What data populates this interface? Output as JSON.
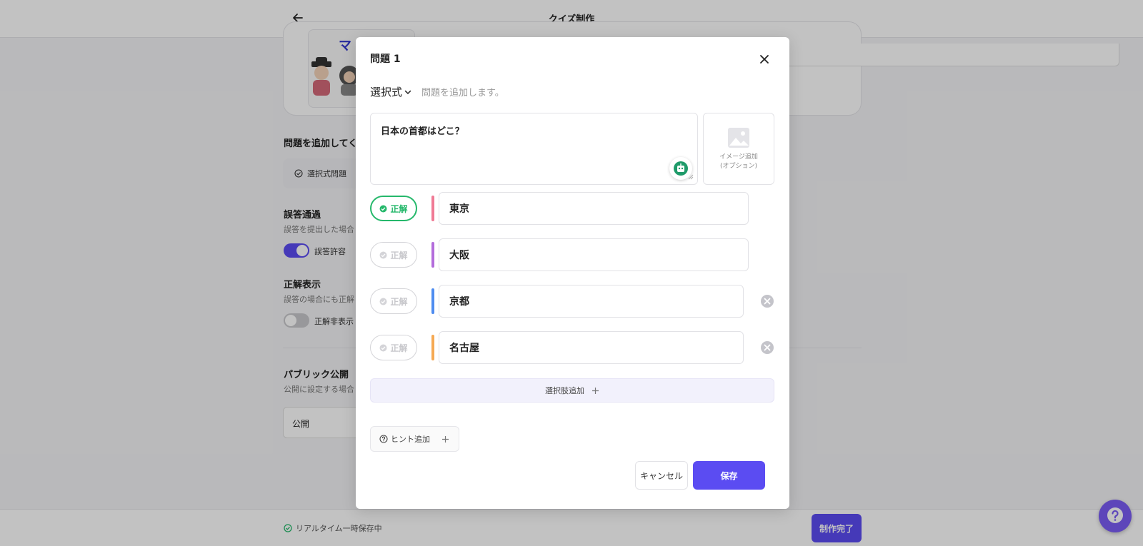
{
  "header": {
    "title": "クイズ制作"
  },
  "background": {
    "card_logo_text": "マ",
    "add_question_label": "問題を追加してく",
    "choice_question_pill": "選択式問題",
    "wrong_pass": {
      "title": "誤答通過",
      "desc": "誤答を提出した場合",
      "toggle_label": "誤答許容"
    },
    "show_answer": {
      "title": "正解表示",
      "desc": "誤答の場合にも正解",
      "toggle_label": "正解非表示"
    },
    "public": {
      "title": "パブリック公開",
      "desc": "公開に設定する場合",
      "select_value": "公開"
    },
    "saving_status": "リアルタイム一時保存中",
    "done_button": "制作完了"
  },
  "modal": {
    "title": "問題 1",
    "question_type": "選択式",
    "type_hint": "問題を追加します。",
    "question_text": "日本の首都はどこ？",
    "image_add_label_1": "イメージ追加",
    "image_add_label_2": "(オプション)",
    "correct_label": "正解",
    "answers": [
      {
        "text": "東京",
        "correct": true,
        "color": "#f07a95"
      },
      {
        "text": "大阪",
        "correct": false,
        "color": "#b36cdb"
      },
      {
        "text": "京都",
        "correct": false,
        "color": "#4e8cf0"
      },
      {
        "text": "名古屋",
        "correct": false,
        "color": "#f5a953"
      }
    ],
    "add_choice": "選択肢追加",
    "add_hint": "ヒント追加",
    "cancel": "キャンセル",
    "save": "保存"
  },
  "colors": {
    "accent": "#5b4cf2",
    "correct": "#25b86b",
    "help_fab": "#7b5cf5"
  }
}
